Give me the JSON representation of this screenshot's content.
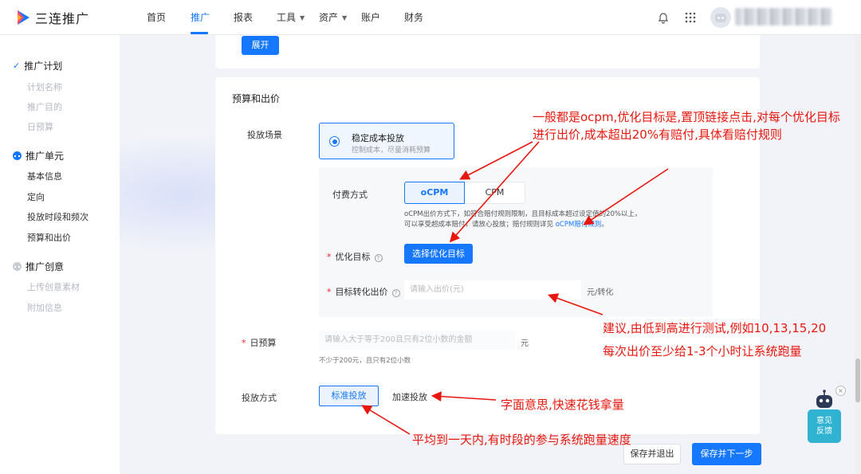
{
  "app": {
    "brand": "三连推广"
  },
  "nav": {
    "items": [
      {
        "label": "首页",
        "active": false,
        "has_caret": false
      },
      {
        "label": "推广",
        "active": true,
        "has_caret": false
      },
      {
        "label": "报表",
        "active": false,
        "has_caret": false
      },
      {
        "label": "工具",
        "active": false,
        "has_caret": true
      },
      {
        "label": "资产",
        "active": false,
        "has_caret": true
      },
      {
        "label": "账户",
        "active": false,
        "has_caret": false
      },
      {
        "label": "财务",
        "active": false,
        "has_caret": false
      }
    ],
    "icons": [
      "bell-icon",
      "apps-grid-icon",
      "avatar"
    ]
  },
  "sidebar": {
    "sections": [
      {
        "title": "推广计划",
        "icon": "check-icon",
        "items": [
          "计划名称",
          "推广目的",
          "日预算"
        ],
        "items_muted": true
      },
      {
        "title": "推广单元",
        "icon": "progress-dots-icon",
        "items": [
          "基本信息",
          "定向",
          "投放时段和频次",
          "预算和出价"
        ],
        "items_muted": false
      },
      {
        "title": "推广创意",
        "icon": "pending-dots-icon",
        "items": [
          "上传创意素材",
          "附加信息"
        ],
        "items_muted": true
      }
    ]
  },
  "main": {
    "expand_button": "展开",
    "section_title": "预算和出价",
    "scene": {
      "label": "投放场景",
      "option_title": "稳定成本投放",
      "option_sub": "控制成本，尽量消耗预算"
    },
    "payment": {
      "label": "付费方式",
      "options": [
        "oCPM",
        "CPM"
      ],
      "note_line1": "oCPM出价方式下，如符合赔付规则限制，且目标成本超过设定值的20%以上，",
      "note_line2_prefix": "可以享受超成本赔付，请放心投放；赔付规则详见",
      "note_link": "oCPM赔付规则",
      "note_suffix": "。"
    },
    "optimize": {
      "label": "优化目标",
      "button": "选择优化目标"
    },
    "bid": {
      "label": "目标转化出价",
      "placeholder": "请输入出价(元)",
      "unit": "元/转化"
    },
    "daily_budget": {
      "label": "日预算",
      "placeholder": "请输入大于等于200且只有2位小数的金额",
      "unit": "元",
      "hint": "不少于200元，且只有2位小数"
    },
    "method": {
      "label": "投放方式",
      "options": [
        "标准投放",
        "加速投放"
      ]
    }
  },
  "footer": {
    "save_exit": "保存并退出",
    "save_next": "保存并下一步"
  },
  "feedback": {
    "line1": "意见",
    "line2": "反馈",
    "close": "×"
  },
  "annotations": {
    "a1_line1": "一般都是ocpm,优化目标是,置顶链接点击,对每个优化目标",
    "a1_line2": "进行出价,成本超出20%有赔付,具体看赔付规则",
    "a2_line1": "建议,由低到高进行测试,例如10,13,15,20",
    "a2_line2": "每次出价至少给1-3个小时让系统跑量",
    "a3": "字面意思,快速花钱拿量",
    "a4": "平均到一天内,有时段的参与系统跑量速度"
  },
  "colors": {
    "accent": "#1677ff",
    "annotation": "#e8170e",
    "feedback": "#2fb3d1"
  }
}
